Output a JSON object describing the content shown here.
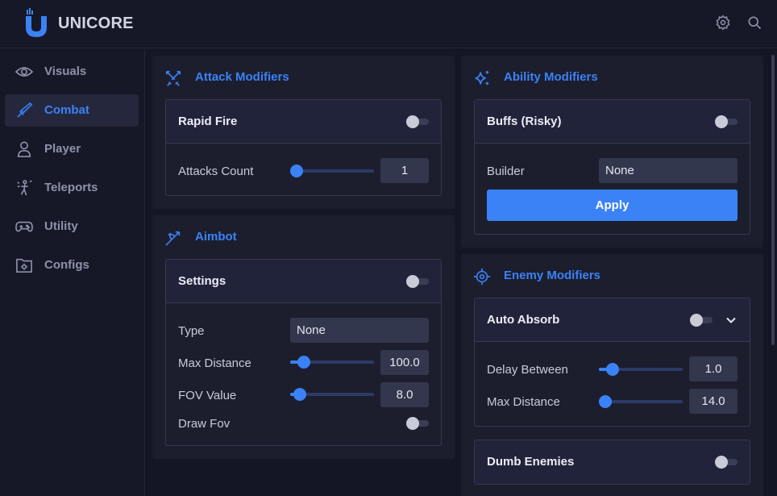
{
  "app": {
    "brand": "UNICORE"
  },
  "header": {
    "settings_icon": "gear-icon",
    "search_icon": "search-icon"
  },
  "sidebar": {
    "items": [
      {
        "label": "Visuals",
        "icon": "eye-icon",
        "active": false
      },
      {
        "label": "Combat",
        "icon": "sword-icon",
        "active": true
      },
      {
        "label": "Player",
        "icon": "user-icon",
        "active": false
      },
      {
        "label": "Teleports",
        "icon": "teleport-icon",
        "active": false
      },
      {
        "label": "Utility",
        "icon": "gamepad-icon",
        "active": false
      },
      {
        "label": "Configs",
        "icon": "folder-gear-icon",
        "active": false
      }
    ]
  },
  "attack_modifiers": {
    "title": "Attack Modifiers",
    "rapid_fire": {
      "title": "Rapid Fire",
      "enabled": false,
      "attacks_count": {
        "label": "Attacks Count",
        "value": "1",
        "fraction": 0.0
      }
    }
  },
  "aimbot": {
    "title": "Aimbot",
    "settings": {
      "title": "Settings",
      "enabled": false,
      "type": {
        "label": "Type",
        "value": "None"
      },
      "max_distance": {
        "label": "Max Distance",
        "value": "100.0",
        "fraction": 0.1
      },
      "fov_value": {
        "label": "FOV Value",
        "value": "8.0",
        "fraction": 0.05
      },
      "draw_fov": {
        "label": "Draw Fov",
        "enabled": false
      }
    }
  },
  "ability_modifiers": {
    "title": "Ability Modifiers",
    "buffs": {
      "title": "Buffs (Risky)",
      "enabled": false,
      "builder": {
        "label": "Builder",
        "value": "None"
      },
      "apply_label": "Apply"
    }
  },
  "enemy_modifiers": {
    "title": "Enemy Modifiers",
    "auto_absorb": {
      "title": "Auto Absorb",
      "enabled": false,
      "delay_between": {
        "label": "Delay Between",
        "value": "1.0",
        "fraction": 0.1
      },
      "max_distance": {
        "label": "Max Distance",
        "value": "14.0",
        "fraction": 0.0
      }
    },
    "dumb_enemies": {
      "title": "Dumb Enemies",
      "enabled": false
    }
  },
  "colors": {
    "accent": "#3b82f6",
    "background": "#141625",
    "panel": "#1c1e2e",
    "input": "#33374d"
  }
}
